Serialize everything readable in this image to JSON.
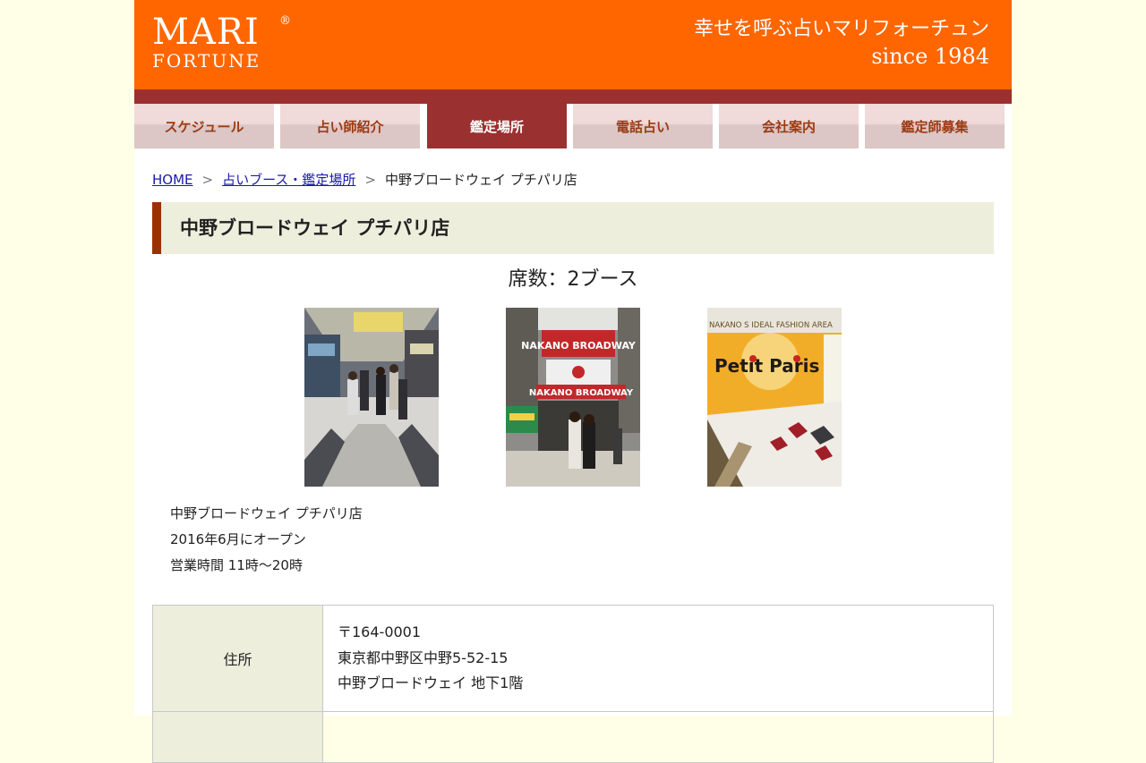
{
  "header": {
    "logo_main": "MARI",
    "logo_reg": "®",
    "logo_sub": "FORTUNE",
    "tagline": "幸せを呼ぶ占いマリフォーチュン",
    "since": "since 1984",
    "colors": {
      "orange": "#ff6600",
      "dark_red": "#9b3030",
      "title_bg": "#eeeedd"
    }
  },
  "nav": {
    "items": [
      {
        "label": "スケジュール"
      },
      {
        "label": "占い師紹介"
      },
      {
        "label": "鑑定場所"
      },
      {
        "label": "電話占い"
      },
      {
        "label": "会社案内"
      },
      {
        "label": "鑑定師募集"
      }
    ],
    "active_index": 2
  },
  "breadcrumb": {
    "home": "HOME",
    "sep": ">",
    "parent": "占いブース・鑑定場所",
    "current": "中野ブロードウェイ プチパリ店"
  },
  "page": {
    "title": "中野ブロードウェイ プチパリ店",
    "seats": "席数：2ブース",
    "photos": {
      "photo2_sign_top": "NAKANO BROADWAY",
      "photo2_sign_bottom": "NAKANO BROADWAY",
      "photo3_banner": "NAKANO S IDEAL FASHION AREA",
      "photo3_logo": "Petit Paris"
    },
    "description": [
      "中野ブロードウェイ プチパリ店",
      "2016年6月にオープン",
      "営業時間 11時〜20時"
    ]
  },
  "info_table": {
    "address_label": "住所",
    "address_lines": [
      "〒164-0001",
      "東京都中野区中野5-52-15",
      "中野ブロードウェイ 地下1階"
    ]
  }
}
